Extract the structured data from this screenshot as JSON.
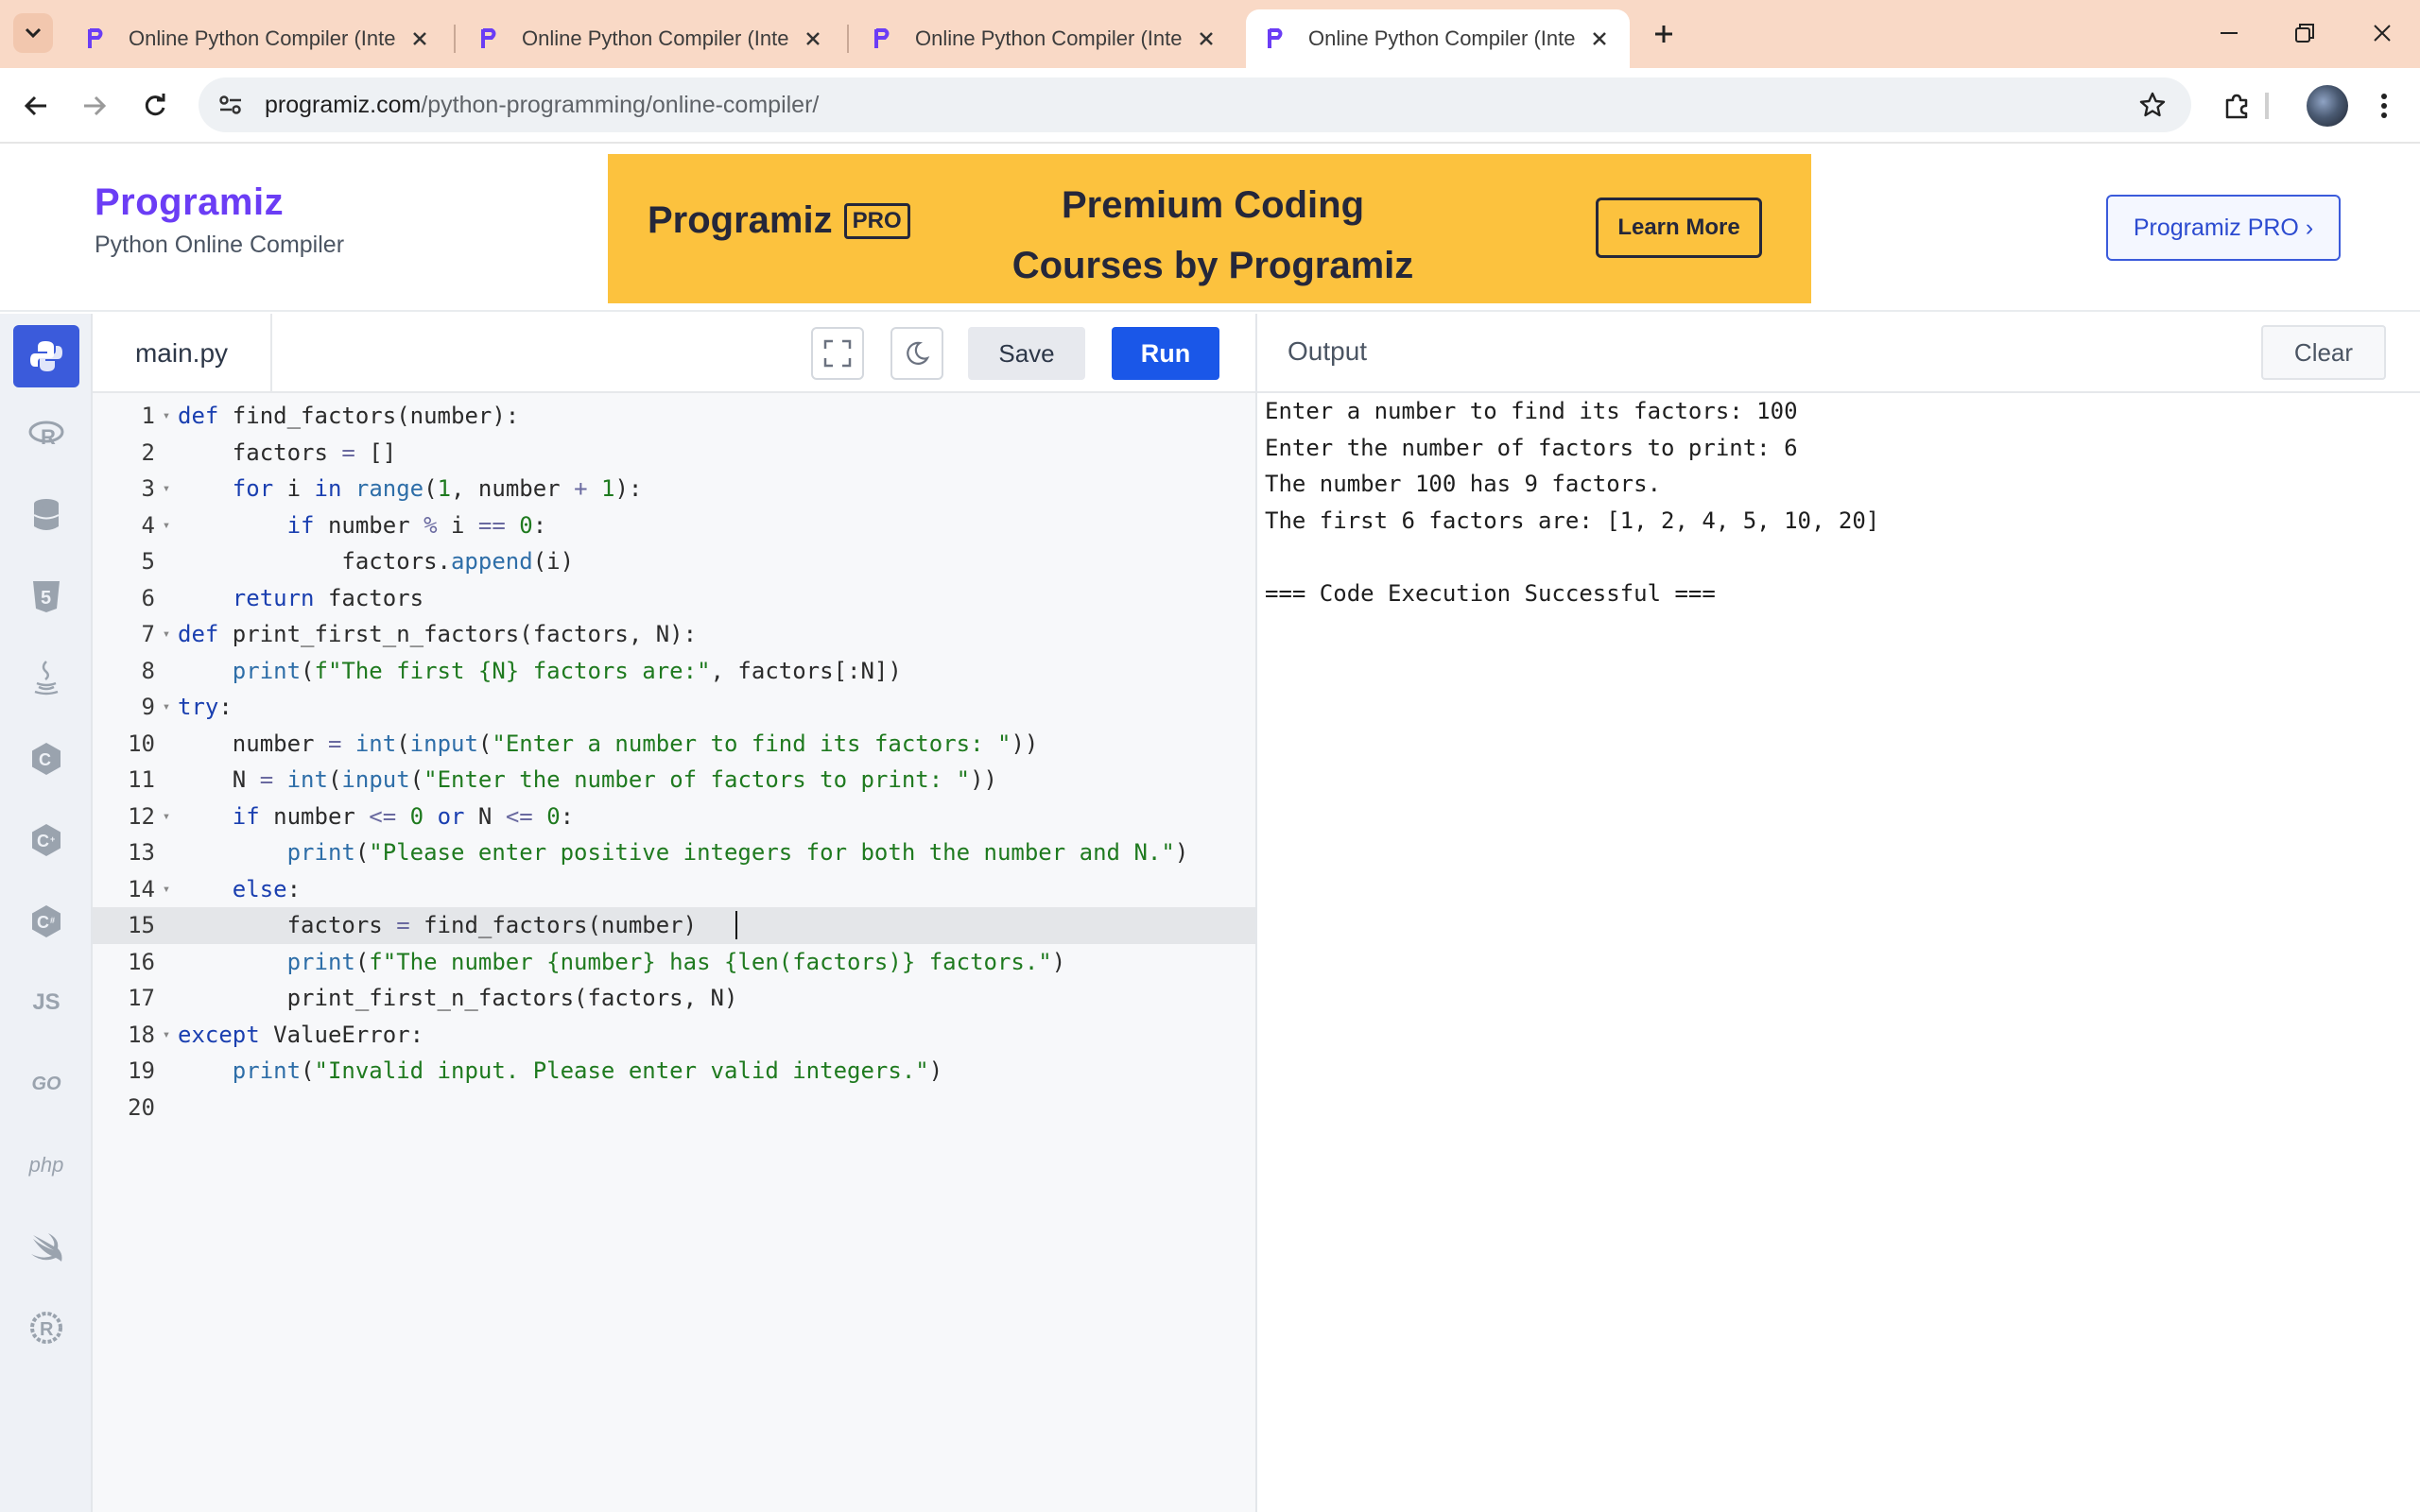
{
  "browser": {
    "tabs": [
      {
        "title": "Online Python Compiler (Interpreter)",
        "active": false
      },
      {
        "title": "Online Python Compiler (Interpreter)",
        "active": false
      },
      {
        "title": "Online Python Compiler (Interpreter)",
        "active": false
      },
      {
        "title": "Online Python Compiler (Interpreter)",
        "active": true
      }
    ],
    "url_host": "programiz.com",
    "url_path": "/python-programming/online-compiler/"
  },
  "header": {
    "logo": "Programiz",
    "subtitle": "Python Online Compiler",
    "banner": {
      "logo": "Programiz",
      "badge": "PRO",
      "headline_line1": "Premium Coding",
      "headline_line2": "Courses by Programiz",
      "cta": "Learn More"
    },
    "pro_button": "Programiz PRO ›"
  },
  "languages": [
    "python-icon",
    "r-icon",
    "sql-icon",
    "html-icon",
    "java-icon",
    "c-icon",
    "cpp-icon",
    "csharp-icon",
    "JS",
    "GO",
    "php",
    "swift-icon",
    "rust-icon"
  ],
  "editor": {
    "filename": "main.py",
    "save_label": "Save",
    "run_label": "Run",
    "current_line": 15,
    "lines": [
      "def find_factors(number):",
      "    factors = []",
      "    for i in range(1, number + 1):",
      "        if number % i == 0:",
      "            factors.append(i)",
      "    return factors",
      "def print_first_n_factors(factors, N):",
      "    print(f\"The first {N} factors are:\", factors[:N])",
      "try:",
      "    number = int(input(\"Enter a number to find its factors: \"))",
      "    N = int(input(\"Enter the number of factors to print: \"))",
      "    if number <= 0 or N <= 0:",
      "        print(\"Please enter positive integers for both the number and N.\")",
      "    else:",
      "        factors = find_factors(number)",
      "        print(f\"The number {number} has {len(factors)} factors.\")",
      "        print_first_n_factors(factors, N)",
      "except ValueError:",
      "    print(\"Invalid input. Please enter valid integers.\")",
      ""
    ],
    "foldable_lines": [
      1,
      3,
      4,
      7,
      9,
      12,
      14,
      18
    ]
  },
  "output": {
    "title": "Output",
    "clear_label": "Clear",
    "lines": [
      "Enter a number to find its factors: 100",
      "Enter the number of factors to print: 6",
      "The number 100 has 9 factors.",
      "The first 6 factors are: [1, 2, 4, 5, 10, 20]",
      "",
      "=== Code Execution Successful ==="
    ]
  },
  "colors": {
    "tabbar": "#f9d9c6",
    "banner": "#fcc23e",
    "run_button": "#1a57e8",
    "brand_purple": "#6b3df5"
  }
}
